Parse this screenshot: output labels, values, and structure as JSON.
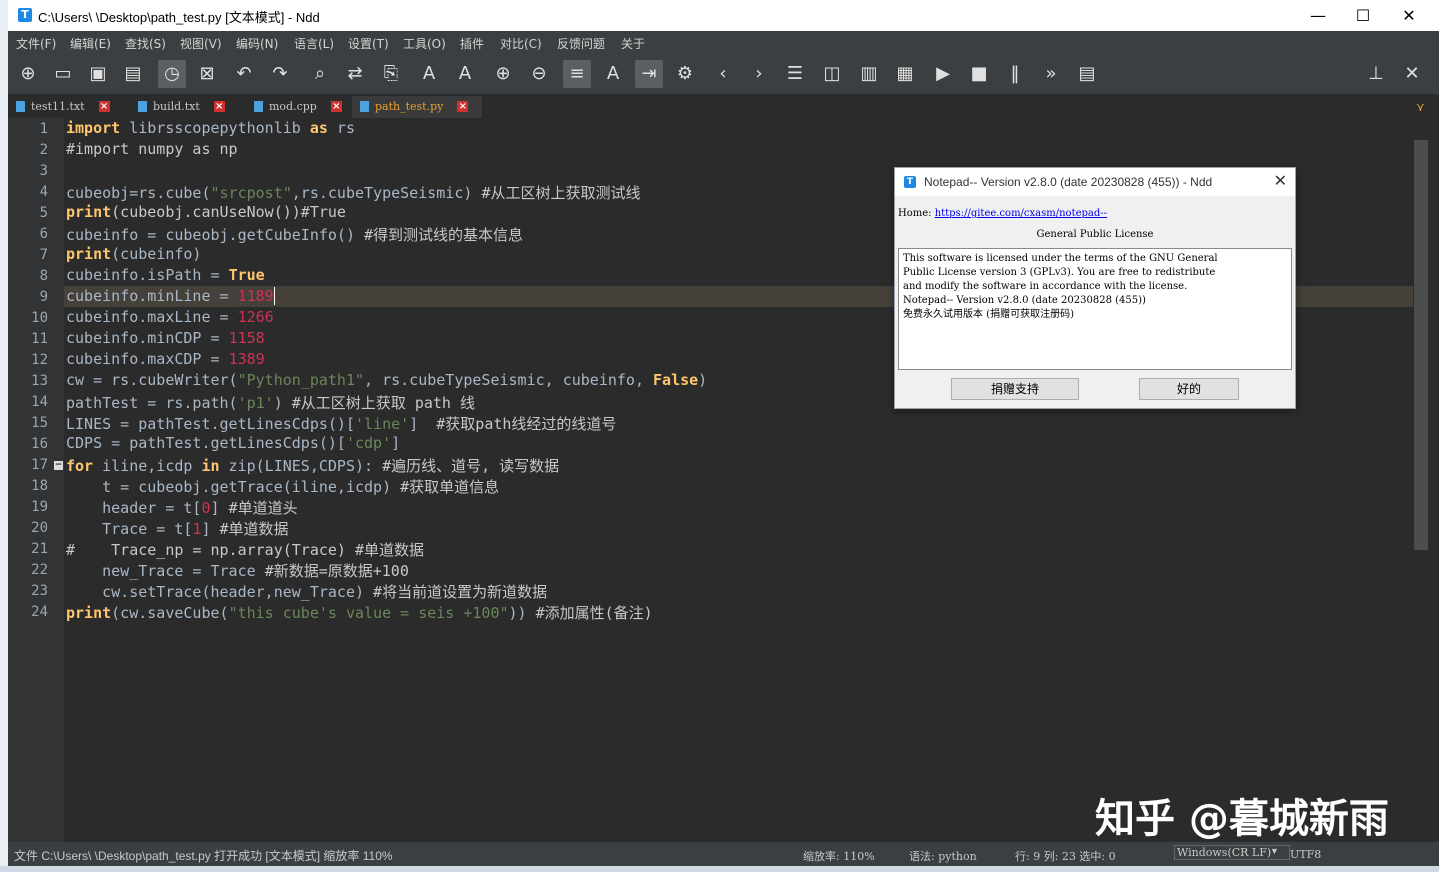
{
  "window": {
    "title": "C:\\Users\\     \\Desktop\\path_test.py [文本模式] - Ndd",
    "app_icon": "T",
    "minimize": "—",
    "maximize": "☐",
    "close": "✕"
  },
  "menu": [
    "文件(F)",
    "编辑(E)",
    "查找(S)",
    "视图(V)",
    "编码(N)",
    "语言(L)",
    "设置(T)",
    "工具(O)",
    "插件",
    "对比(C)",
    "反馈问题",
    "关于"
  ],
  "toolbar_icons": [
    "new-file-icon",
    "open-folder-icon",
    "save-icon",
    "save-all-icon",
    "clock-icon",
    "close-file-icon",
    "undo-icon",
    "redo-icon",
    "find-icon",
    "replace-icon",
    "find-in-files-icon",
    "text-size-icon",
    "text-format-icon",
    "zoom-in-icon",
    "zoom-out-icon",
    "wrap-icon",
    "font-icon",
    "indent-icon",
    "settings-doc-icon",
    "prev-icon",
    "next-icon",
    "doc-list-icon",
    "split-icon",
    "column-icon",
    "hex-icon",
    "play-icon",
    "stop-icon",
    "pause-icon",
    "fast-forward-icon",
    "save-macro-icon"
  ],
  "tabs": [
    {
      "name": "test11.txt",
      "active": false
    },
    {
      "name": "build.txt",
      "active": false
    },
    {
      "name": "mod.cpp",
      "active": false
    },
    {
      "name": "path_test.py",
      "active": true
    }
  ],
  "editor": {
    "line_numbers": [
      "1",
      "2",
      "3",
      "4",
      "5",
      "6",
      "7",
      "8",
      "9",
      "10",
      "11",
      "12",
      "13",
      "14",
      "15",
      "16",
      "17",
      "18",
      "19",
      "20",
      "21",
      "22",
      "23",
      "24"
    ],
    "code_tokens": {
      "l1_import": "import",
      "l1_mod": " librsscopepythonlib ",
      "l1_as": "as",
      "l1_rs": " rs",
      "l2": "#import numpy as np",
      "l4_a": "cubeobj=rs.cube(",
      "l4_str": "\"srcpost\"",
      "l4_b": ",rs.cubeTypeSeismic) ",
      "l4_c": "#从工区树上获取测试线",
      "l5_print": "print",
      "l5_b": "(cubeobj.canUseNow())#True",
      "l6_a": "cubeinfo = cubeobj.getCubeInfo() ",
      "l6_c": "#得到测试线的基本信息",
      "l7_print": "print",
      "l7_b": "(cubeinfo)",
      "l8_a": "cubeinfo.isPath = ",
      "l8_true": "True",
      "l9_a": "cubeinfo.minLine = ",
      "l9_n": "1189",
      "l10_a": "cubeinfo.maxLine = ",
      "l10_n": "1266",
      "l11_a": "cubeinfo.minCDP = ",
      "l11_n": "1158",
      "l12_a": "cubeinfo.maxCDP = ",
      "l12_n": "1389",
      "l13_a": "cw = rs.cubeWriter(",
      "l13_str": "\"Python_path1\"",
      "l13_b": ", rs.cubeTypeSeismic, cubeinfo, ",
      "l13_false": "False",
      "l13_c": ")",
      "l14_a": "pathTest = rs.path(",
      "l14_str": "'p1'",
      "l14_b": ") ",
      "l14_c": "#从工区树上获取 path 线",
      "l15_a": "LINES = pathTest.getLinesCdps()[",
      "l15_str": "'line'",
      "l15_b": "]  ",
      "l15_c": "#获取path线经过的线道号",
      "l16_a": "CDPS = pathTest.getLinesCdps()[",
      "l16_str": "'cdp'",
      "l16_b": "]",
      "l17_for": "for",
      "l17_a": " iline,icdp ",
      "l17_in": "in",
      "l17_b": " zip(LINES,CDPS): ",
      "l17_c": "#遍历线、道号, 读写数据",
      "l18_a": "    t = cubeobj.getTrace(iline,icdp) ",
      "l18_c": "#获取单道信息",
      "l19_a": "    header = t[",
      "l19_n": "0",
      "l19_b": "] ",
      "l19_c": "#单道道头",
      "l20_a": "    Trace = t[",
      "l20_n": "1",
      "l20_b": "] ",
      "l20_c": "#单道数据",
      "l21_a": "#    Trace_np = np.array(Trace) ",
      "l21_c": "#单道数据",
      "l22_a": "    new_Trace = Trace ",
      "l22_c": "#新数据=原数据+100",
      "l23_a": "    cw.setTrace(header,new_Trace) ",
      "l23_c": "#将当前道设置为新道数据",
      "l24_print": "print",
      "l24_a": "(cw.saveCube(",
      "l24_str": "\"this cube's value = seis +100\"",
      "l24_b": ")) ",
      "l24_c": "#添加属性(备注)"
    }
  },
  "fold_marker": "−",
  "dialog": {
    "title": "Notepad-- Version v2.8.0 (date 20230828 (455)) - Ndd",
    "home_label": "Home: ",
    "home_url": "https://gitee.com/cxasm/notepad--",
    "license_title": "General Public License",
    "license_lines": [
      "This software is licensed under the terms of the GNU General",
      "Public License version 3 (GPLv3). You are free to redistribute",
      "and modify the software in accordance with the license.",
      "Notepad-- Version v2.8.0 (date 20230828 (455))",
      "免费永久试用版本 (捐赠可获取注册码)"
    ],
    "donate_button": "捐赠支持",
    "ok_button": "好的",
    "close": "✕"
  },
  "statusbar": {
    "file_info": "文件 C:\\Users\\        \\Desktop\\path_test.py 打开成功 [文本模式] 缩放率 110%",
    "zoom": "缩放率: 110%",
    "syntax": "语法: python",
    "position": "行: 9 列: 23 选中: 0",
    "line_ending": "Windows(CR LF)",
    "encoding": "UTF8"
  },
  "watermark": "知乎 @暮城新雨",
  "colors": {
    "editor_bg": "#2b2b2b",
    "keyword": "#ffc66d",
    "string": "#6a8759",
    "number": "#cc3355",
    "active_tab": "#e8a032"
  }
}
